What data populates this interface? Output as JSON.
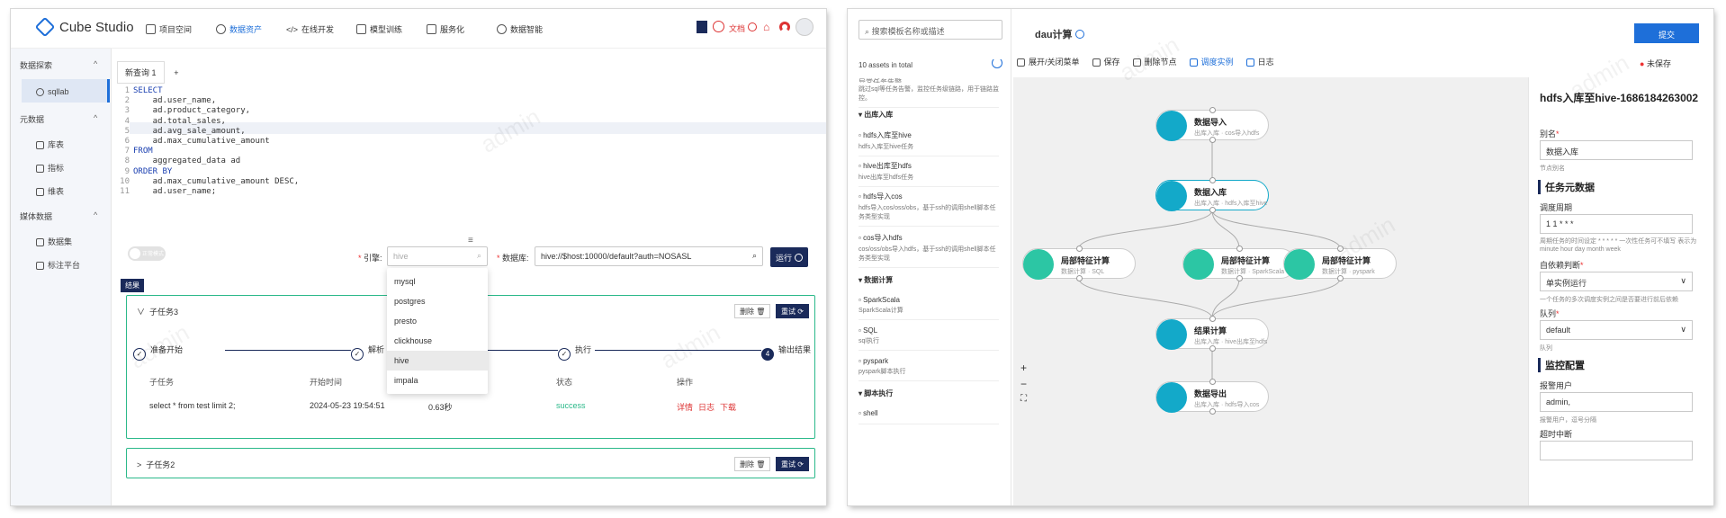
{
  "left_panel": {
    "app_name": "Cube Studio",
    "nav": [
      "项目空间",
      "数据资产",
      "在线开发",
      "模型训练",
      "服务化",
      "数据智能"
    ],
    "header_right": {
      "docs": "文档"
    },
    "sidebar": {
      "groups": [
        {
          "label": "数据探索",
          "items": [
            "sqllab"
          ]
        },
        {
          "label": "元数据",
          "items": [
            "库表",
            "指标",
            "维表"
          ]
        },
        {
          "label": "媒体数据",
          "items": [
            "数据集",
            "标注平台"
          ]
        }
      ]
    },
    "editor_tab": "新查询 1",
    "add_tab": "+",
    "code_lines": [
      "SELECT",
      "    ad.user_name,",
      "    ad.product_category,",
      "    ad.total_sales,",
      "    ad.avg_sale_amount,",
      "    ad.max_cumulative_amount",
      "FROM",
      "    aggregated_data ad",
      "ORDER BY",
      "    ad.max_cumulative_amount DESC,",
      "    ad.user_name;"
    ],
    "toggle_label": "正常模式",
    "engine_label": "引擎:",
    "engine_value": "hive",
    "db_label": "数据库:",
    "db_value": "hive://$host:10000/default?auth=NOSASL",
    "run_button": "运行",
    "engine_options": [
      "mysql",
      "postgres",
      "presto",
      "clickhouse",
      "hive",
      "impala"
    ],
    "result_tag": "结果",
    "task1": {
      "title": "子任务3",
      "delete": "删除",
      "retry": "重试",
      "steps": [
        "准备开始",
        "解析",
        "执行",
        "输出结果"
      ],
      "step4_num": "4",
      "headers": [
        "子任务",
        "开始时间",
        "状态",
        "操作"
      ],
      "row": {
        "sql": "select * from test limit 2;",
        "start": "2024-05-23 19:54:51",
        "duration": "0.63秒",
        "status": "success",
        "ops": [
          "详情",
          "日志",
          "下载"
        ]
      }
    },
    "task2": {
      "title": "子任务2",
      "delete": "删除",
      "retry": "重试"
    },
    "watermark": "admin"
  },
  "right_panel": {
    "search_placeholder": "搜索模板名称或描述",
    "assets_total": "10 assets in total",
    "cut_item": {
      "title": "异常任务告警",
      "desc": "跳过sql等任务告警，监控任务级链路，用于链路监控。"
    },
    "groups": [
      {
        "label": "出库入库",
        "items": [
          {
            "title": "hdfs入库至hive",
            "desc": "hdfs入库至hive任务"
          },
          {
            "title": "hive出库至hdfs",
            "desc": "hive出库至hdfs任务"
          },
          {
            "title": "hdfs导入cos",
            "desc": "hdfs导入cos/oss/obs，基于ssh的调用shell脚本任务类型实现"
          },
          {
            "title": "cos导入hdfs",
            "desc": "cos/oss/obs导入hdfs，基于ssh的调用shell脚本任务类型实现"
          }
        ]
      },
      {
        "label": "数据计算",
        "items": [
          {
            "title": "SparkScala",
            "desc": "SparkScala计算"
          },
          {
            "title": "SQL",
            "desc": "sql执行"
          },
          {
            "title": "pyspark",
            "desc": "pyspark脚本执行"
          }
        ]
      },
      {
        "label": "脚本执行",
        "items": [
          {
            "title": "shell",
            "desc": ""
          }
        ]
      }
    ],
    "pipeline_name": "dau计算",
    "submit": "提交",
    "toolbar": [
      "展开/关闭菜单",
      "保存",
      "删除节点",
      "调度实例",
      "日志"
    ],
    "unsaved": "未保存",
    "nodes": [
      {
        "title": "数据导入",
        "sub": "出库入库 · cos导入hdfs",
        "color": "#13a9c9"
      },
      {
        "title": "数据入库",
        "sub": "出库入库 · hdfs入库至hive",
        "color": "#13a9c9"
      },
      {
        "title": "局部特征计算",
        "sub": "数据计算 · SQL",
        "color": "#2cc6a4"
      },
      {
        "title": "局部特征计算",
        "sub": "数据计算 · SparkScala",
        "color": "#2cc6a4"
      },
      {
        "title": "局部特征计算",
        "sub": "数据计算 · pyspark",
        "color": "#2cc6a4"
      },
      {
        "title": "结果计算",
        "sub": "出库入库 · hive出库至hdfs",
        "color": "#13a9c9"
      },
      {
        "title": "数据导出",
        "sub": "出库入库 · hdfs导入cos",
        "color": "#13a9c9"
      }
    ],
    "zoom": [
      "+",
      "−",
      "⛶"
    ],
    "props": {
      "title": "hdfs入库至hive-1686184263002",
      "alias_label": "别名",
      "alias_value": "数据入库",
      "alias_note": "节点别名",
      "section1": "任务元数据",
      "cron_label": "调度周期",
      "cron_value": "1 1 * * *",
      "cron_note": "周期任务的时间设定 * * * * * 一次性任务可不填写 表示为 minute hour day month week",
      "depend_label": "自依赖判断",
      "depend_value": "单实例运行",
      "depend_note": "一个任务的多次调度实例之间是否要进行前后依赖",
      "queue_label": "队列",
      "queue_value": "default",
      "queue_note": "队列",
      "section2": "监控配置",
      "alert_label": "报警用户",
      "alert_value": "admin,",
      "alert_note": "报警用户，逗号分隔",
      "timeout_label": "超时中断"
    }
  }
}
